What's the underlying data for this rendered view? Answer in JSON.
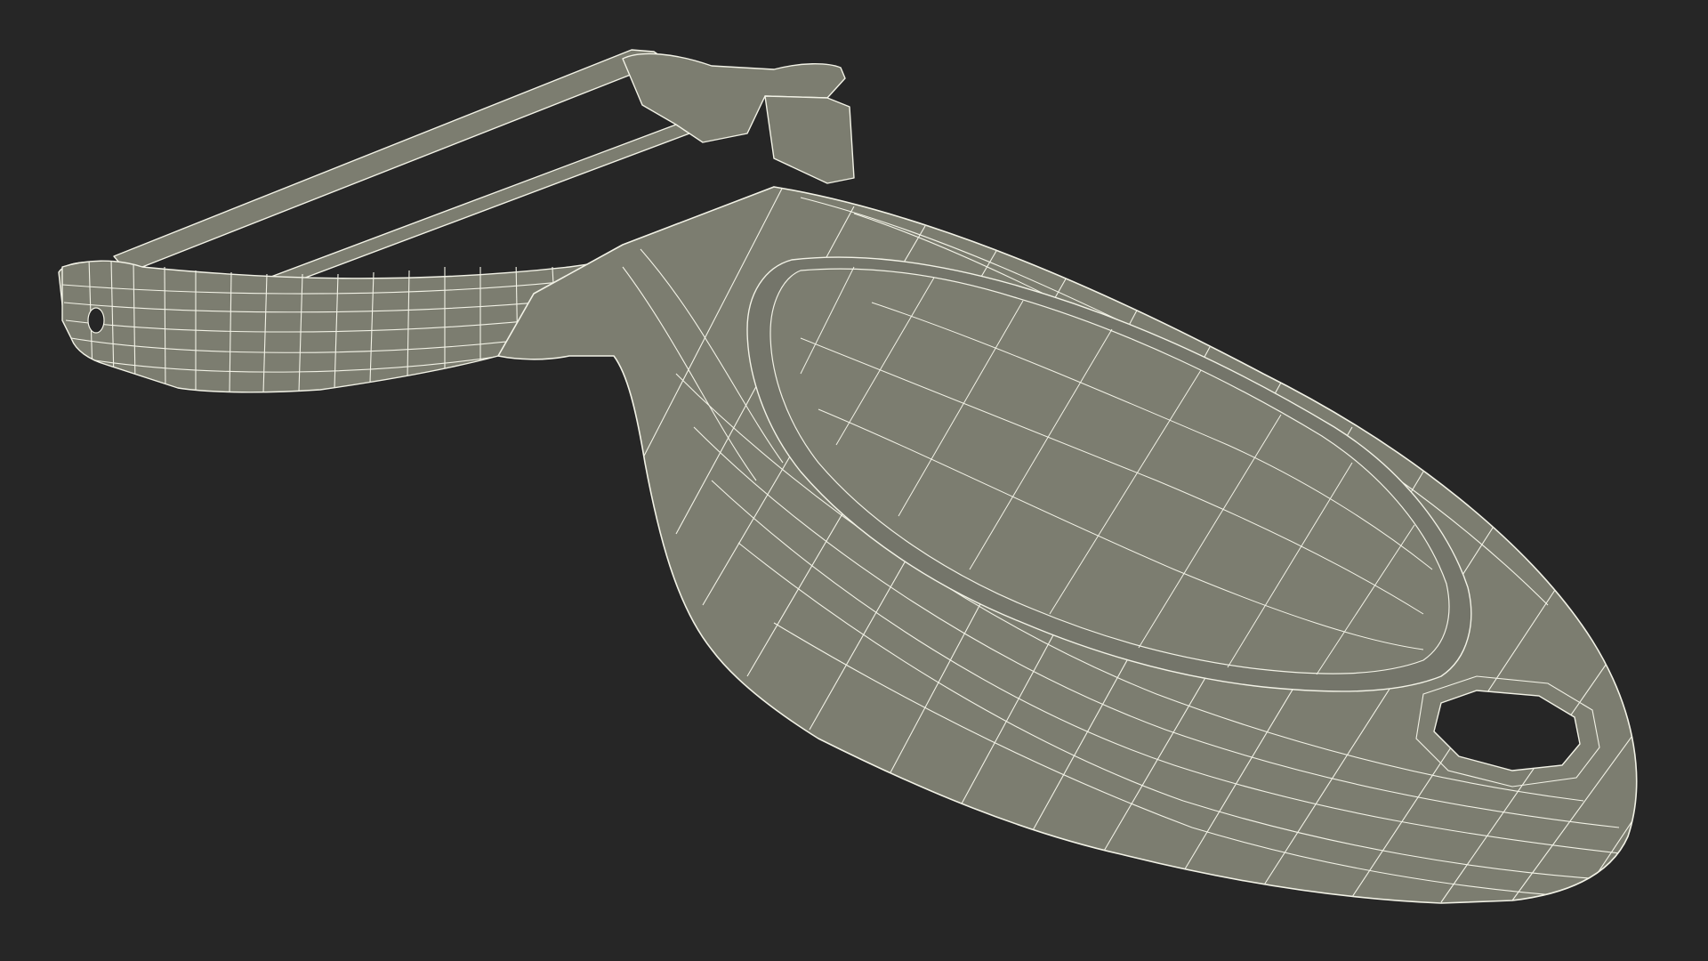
{
  "scene": {
    "subject": "y-peeler-wireframe-render",
    "colors": {
      "background": "#262626",
      "surface": "#7c7d70",
      "surface_shadow": "#6e6f63",
      "wire": "#f2f2e6",
      "cavity": "#262626"
    }
  }
}
